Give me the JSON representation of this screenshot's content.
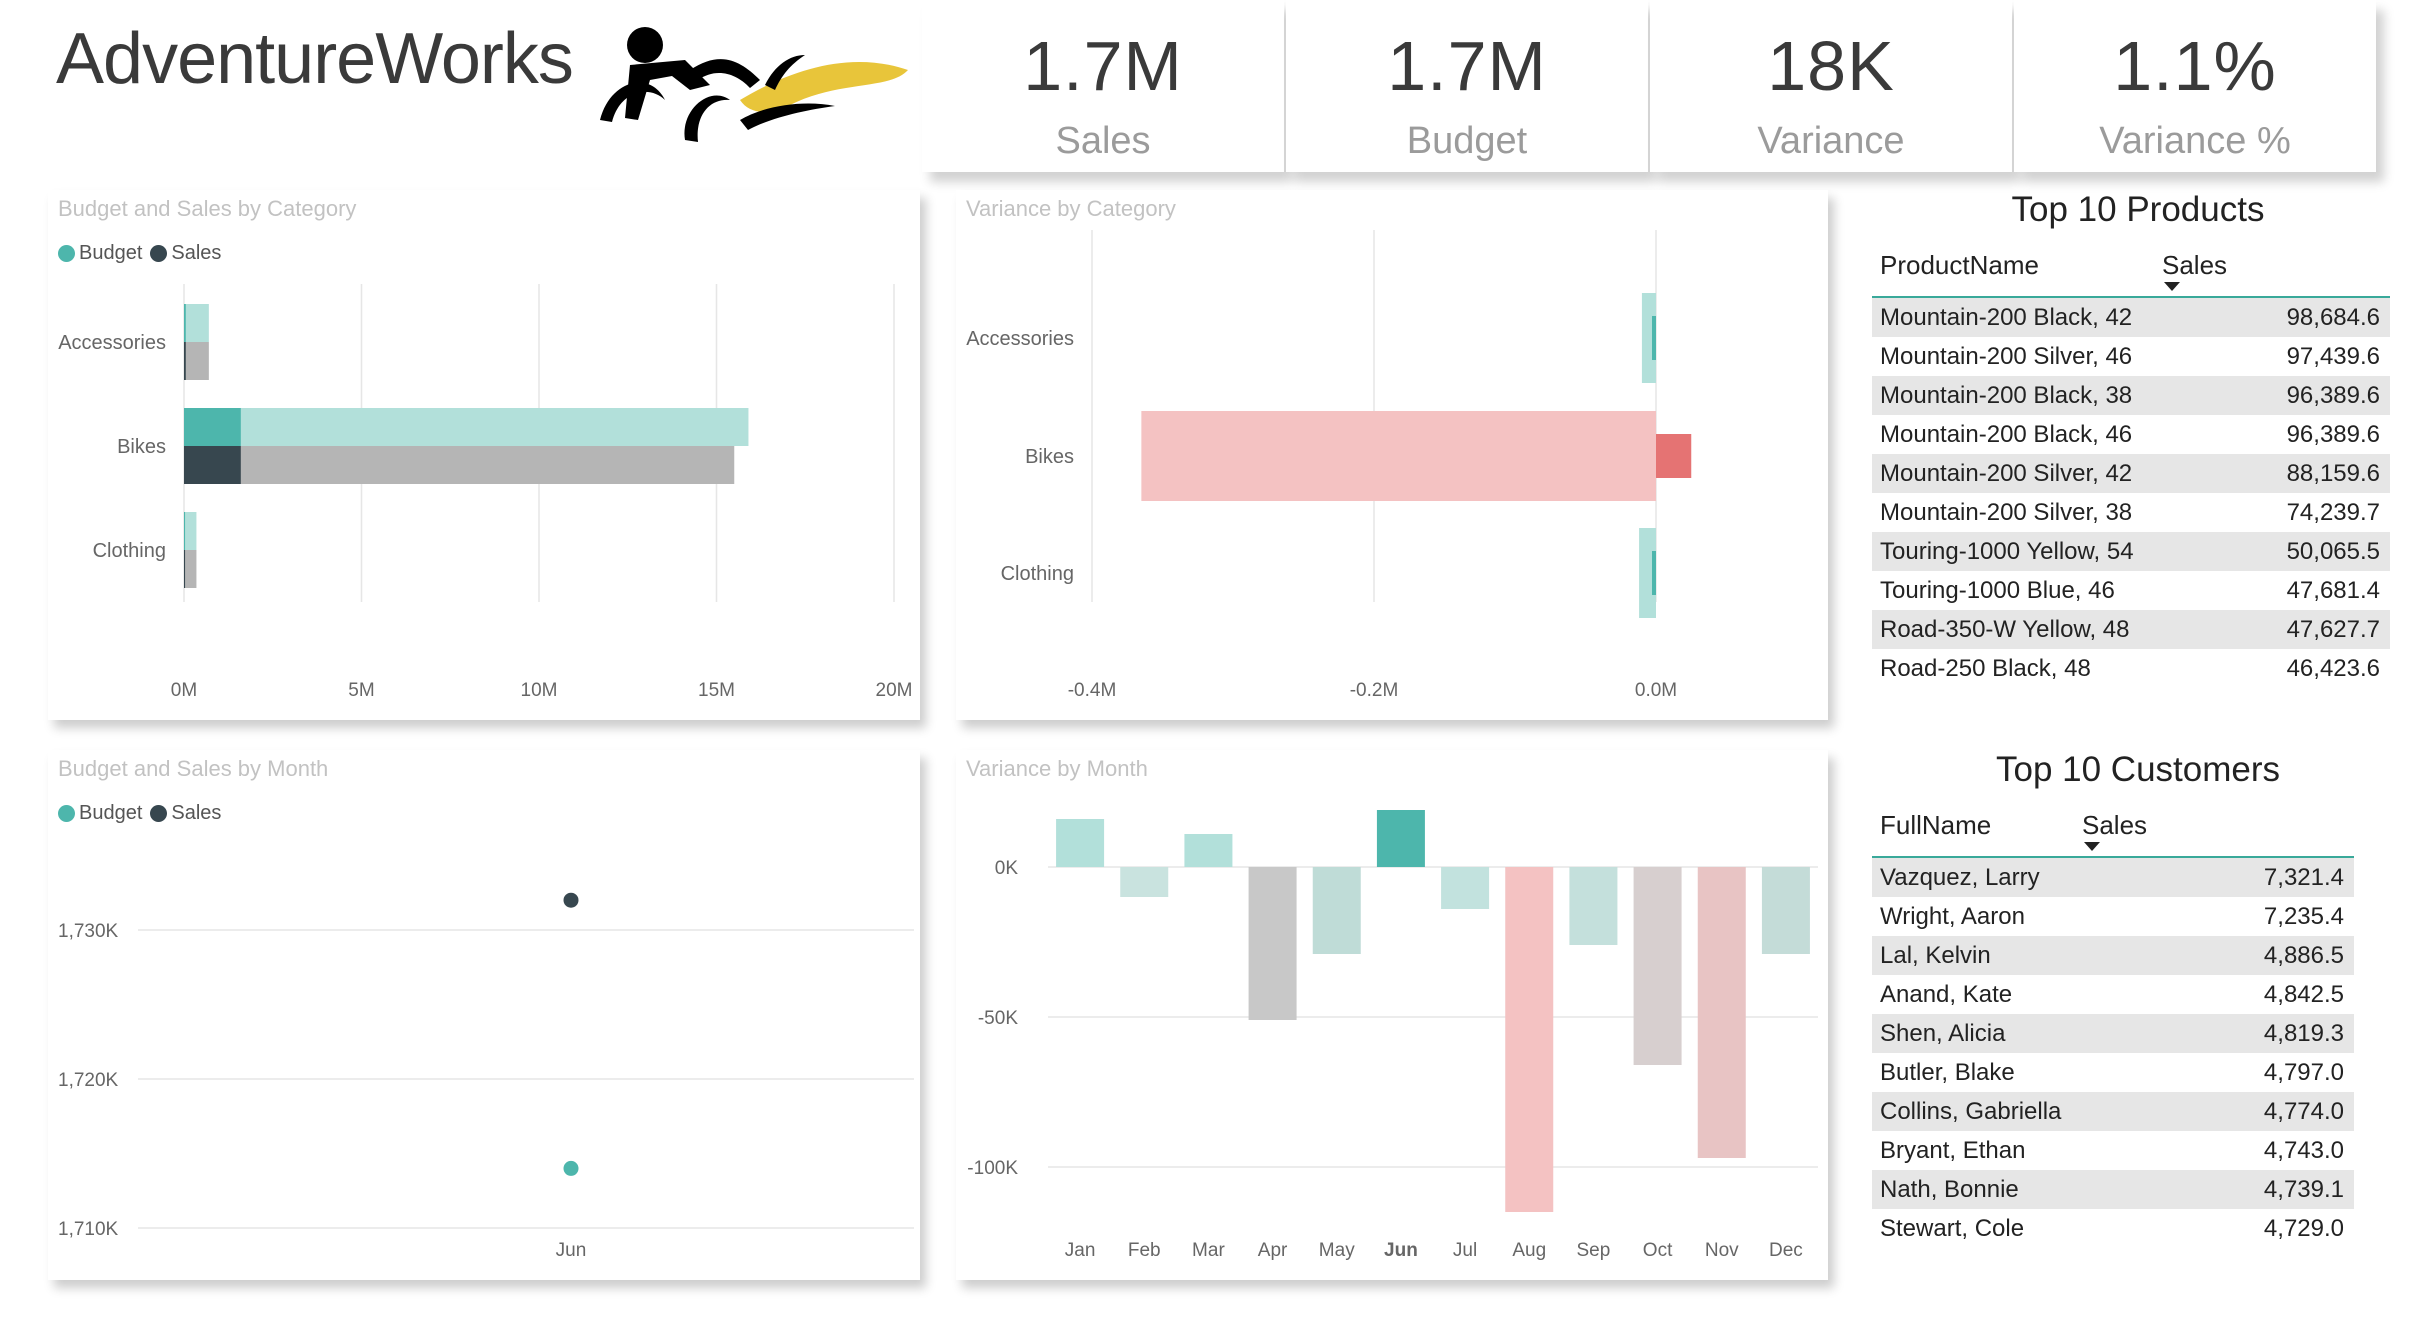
{
  "brand": {
    "name": "AdventureWorks",
    "logo": "cyclist-logo"
  },
  "kpis": [
    {
      "value": "1.7M",
      "label": "Sales"
    },
    {
      "value": "1.7M",
      "label": "Budget"
    },
    {
      "value": "18K",
      "label": "Variance"
    },
    {
      "value": "1.1%",
      "label": "Variance %"
    }
  ],
  "colors": {
    "budget": "#4db6ac",
    "sales": "#37474f",
    "budget_light": "#b2e0da",
    "sales_light": "#b5b5b5",
    "negative": "#e57373",
    "negative_light": "#f4c2c2"
  },
  "legend": {
    "budget": "Budget",
    "sales": "Sales"
  },
  "chart_data": [
    {
      "id": "budget-sales-category",
      "title": "Budget and Sales by Category",
      "type": "bar",
      "orientation": "horizontal",
      "categories": [
        "Accessories",
        "Bikes",
        "Clothing"
      ],
      "series": [
        {
          "name": "Budget",
          "values": [
            0.7,
            15.9,
            0.35
          ],
          "highlighted": [
            0.05,
            1.6,
            0.03
          ]
        },
        {
          "name": "Sales",
          "values": [
            0.7,
            15.5,
            0.35
          ],
          "highlighted": [
            0.05,
            1.6,
            0.03
          ]
        }
      ],
      "xticks": [
        "0M",
        "5M",
        "10M",
        "15M",
        "20M"
      ],
      "tick_values": [
        0,
        5,
        10,
        15,
        20
      ],
      "xlim": [
        0,
        20
      ]
    },
    {
      "id": "variance-category",
      "title": "Variance by Category",
      "type": "bar",
      "orientation": "horizontal",
      "categories": [
        "Accessories",
        "Bikes",
        "Clothing"
      ],
      "values": [
        -0.01,
        -0.365,
        -0.012
      ],
      "highlighted": [
        -0.002,
        0.025,
        -0.001
      ],
      "xticks": [
        "-0.4M",
        "-0.2M",
        "0.0M"
      ],
      "tick_values": [
        -0.4,
        -0.2,
        0.0
      ],
      "xlim": [
        -0.4,
        0.0
      ]
    },
    {
      "id": "budget-sales-month",
      "title": "Budget and Sales by Month",
      "type": "scatter",
      "categories": [
        "Jun"
      ],
      "series": [
        {
          "name": "Budget",
          "values": [
            1714
          ]
        },
        {
          "name": "Sales",
          "values": [
            1732
          ]
        }
      ],
      "yticks": [
        "1,710K",
        "1,720K",
        "1,730K"
      ],
      "tick_values": [
        1710,
        1720,
        1730
      ],
      "ylim": [
        1710,
        1730
      ]
    },
    {
      "id": "variance-month",
      "title": "Variance by Month",
      "type": "bar",
      "categories": [
        "Jan",
        "Feb",
        "Mar",
        "Apr",
        "May",
        "Jun",
        "Jul",
        "Aug",
        "Sep",
        "Oct",
        "Nov",
        "Dec"
      ],
      "values": [
        16,
        -10,
        11,
        -51,
        -29,
        19,
        -14,
        -115,
        -26,
        -66,
        -97,
        -29
      ],
      "highlight_category": "Jun",
      "yticks": [
        "0K",
        "-50K",
        "-100K"
      ],
      "tick_values": [
        0,
        -50,
        -100
      ],
      "ylim": [
        -100,
        0
      ]
    }
  ],
  "top_products": {
    "title": "Top 10 Products",
    "col_name": "ProductName",
    "col_sales": "Sales",
    "rows": [
      {
        "name": "Mountain-200 Black, 42",
        "sales": "98,684.6"
      },
      {
        "name": "Mountain-200 Silver, 46",
        "sales": "97,439.6"
      },
      {
        "name": "Mountain-200 Black, 38",
        "sales": "96,389.6"
      },
      {
        "name": "Mountain-200 Black, 46",
        "sales": "96,389.6"
      },
      {
        "name": "Mountain-200 Silver, 42",
        "sales": "88,159.6"
      },
      {
        "name": "Mountain-200 Silver, 38",
        "sales": "74,239.7"
      },
      {
        "name": "Touring-1000 Yellow, 54",
        "sales": "50,065.5"
      },
      {
        "name": "Touring-1000 Blue, 46",
        "sales": "47,681.4"
      },
      {
        "name": "Road-350-W Yellow, 48",
        "sales": "47,627.7"
      },
      {
        "name": "Road-250 Black, 48",
        "sales": "46,423.6"
      }
    ]
  },
  "top_customers": {
    "title": "Top 10 Customers",
    "col_name": "FullName",
    "col_sales": "Sales",
    "rows": [
      {
        "name": "Vazquez, Larry",
        "sales": "7,321.4"
      },
      {
        "name": "Wright, Aaron",
        "sales": "7,235.4"
      },
      {
        "name": "Lal, Kelvin",
        "sales": "4,886.5"
      },
      {
        "name": "Anand, Kate",
        "sales": "4,842.5"
      },
      {
        "name": "Shen, Alicia",
        "sales": "4,819.3"
      },
      {
        "name": "Butler, Blake",
        "sales": "4,797.0"
      },
      {
        "name": "Collins, Gabriella",
        "sales": "4,774.0"
      },
      {
        "name": "Bryant, Ethan",
        "sales": "4,743.0"
      },
      {
        "name": "Nath, Bonnie",
        "sales": "4,739.1"
      },
      {
        "name": "Stewart, Cole",
        "sales": "4,729.0"
      }
    ]
  }
}
